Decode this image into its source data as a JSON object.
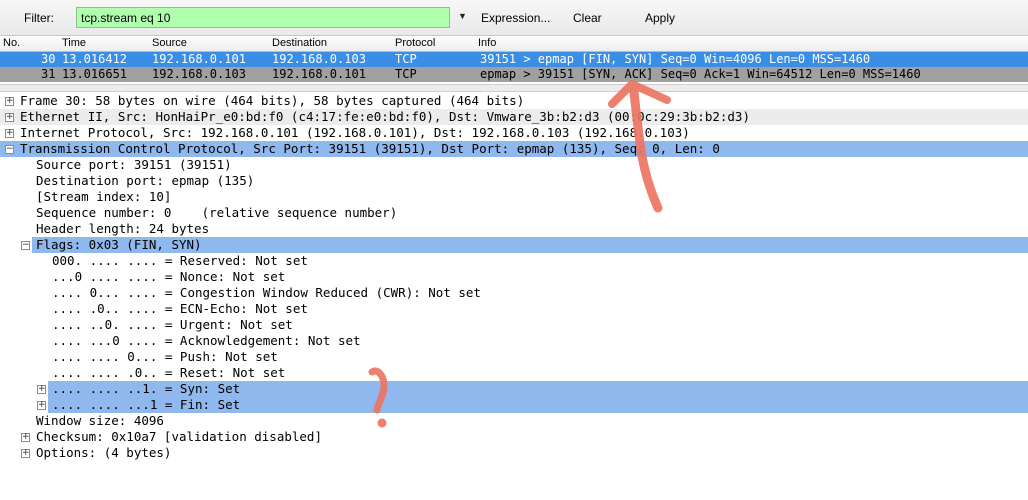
{
  "toolbar": {
    "filter_label": "Filter:",
    "filter_value": "tcp.stream eq 10",
    "expression_label": "Expression...",
    "clear_label": "Clear",
    "apply_label": "Apply"
  },
  "packet_list": {
    "columns": [
      "No.",
      "Time",
      "Source",
      "Destination",
      "Protocol",
      "Info"
    ],
    "rows": [
      {
        "no": "30",
        "time": "13.016412",
        "source": "192.168.0.101",
        "destination": "192.168.0.103",
        "protocol": "TCP",
        "info": "39151 > epmap [FIN, SYN] Seq=0 Win=4096 Len=0 MSS=1460",
        "selected": true
      },
      {
        "no": "31",
        "time": "13.016651",
        "source": "192.168.0.103",
        "destination": "192.168.0.101",
        "protocol": "TCP",
        "info": "epmap > 39151 [SYN, ACK] Seq=0 Ack=1 Win=64512 Len=0 MSS=1460",
        "selected": false
      }
    ]
  },
  "details": {
    "frame": "Frame 30: 58 bytes on wire (464 bits), 58 bytes captured (464 bits)",
    "ethernet": "Ethernet II, Src: HonHaiPr_e0:bd:f0 (c4:17:fe:e0:bd:f0), Dst: Vmware_3b:b2:d3 (00:0c:29:3b:b2:d3)",
    "ip": "Internet Protocol, Src: 192.168.0.101 (192.168.0.101), Dst: 192.168.0.103 (192.168.0.103)",
    "tcp": "Transmission Control Protocol, Src Port: 39151 (39151), Dst Port: epmap (135), Seq: 0, Len: 0",
    "source_port": "Source port: 39151 (39151)",
    "destination_port": "Destination port: epmap (135)",
    "stream_index": "[Stream index: 10]",
    "sequence_number": "Sequence number: 0    (relative sequence number)",
    "header_length": "Header length: 24 bytes",
    "flags": "Flags: 0x03 (FIN, SYN)",
    "flag_bits": [
      "000. .... .... = Reserved: Not set",
      "...0 .... .... = Nonce: Not set",
      ".... 0... .... = Congestion Window Reduced (CWR): Not set",
      ".... .0.. .... = ECN-Echo: Not set",
      ".... ..0. .... = Urgent: Not set",
      ".... ...0 .... = Acknowledgement: Not set",
      ".... .... 0... = Push: Not set",
      ".... .... .0.. = Reset: Not set",
      ".... .... ..1. = Syn: Set",
      ".... .... ...1 = Fin: Set"
    ],
    "window_size": "Window size: 4096",
    "checksum": "Checksum: 0x10a7 [validation disabled]",
    "options": "Options: (4 bytes)"
  },
  "colors": {
    "filter_valid": "#afffaf",
    "selected_row": "#3a8ee6",
    "highlight": "#8fb8ee",
    "annotation": "#ec7563"
  },
  "annotation_marks": [
    "arrow-annotation",
    "question-mark-annotation"
  ]
}
